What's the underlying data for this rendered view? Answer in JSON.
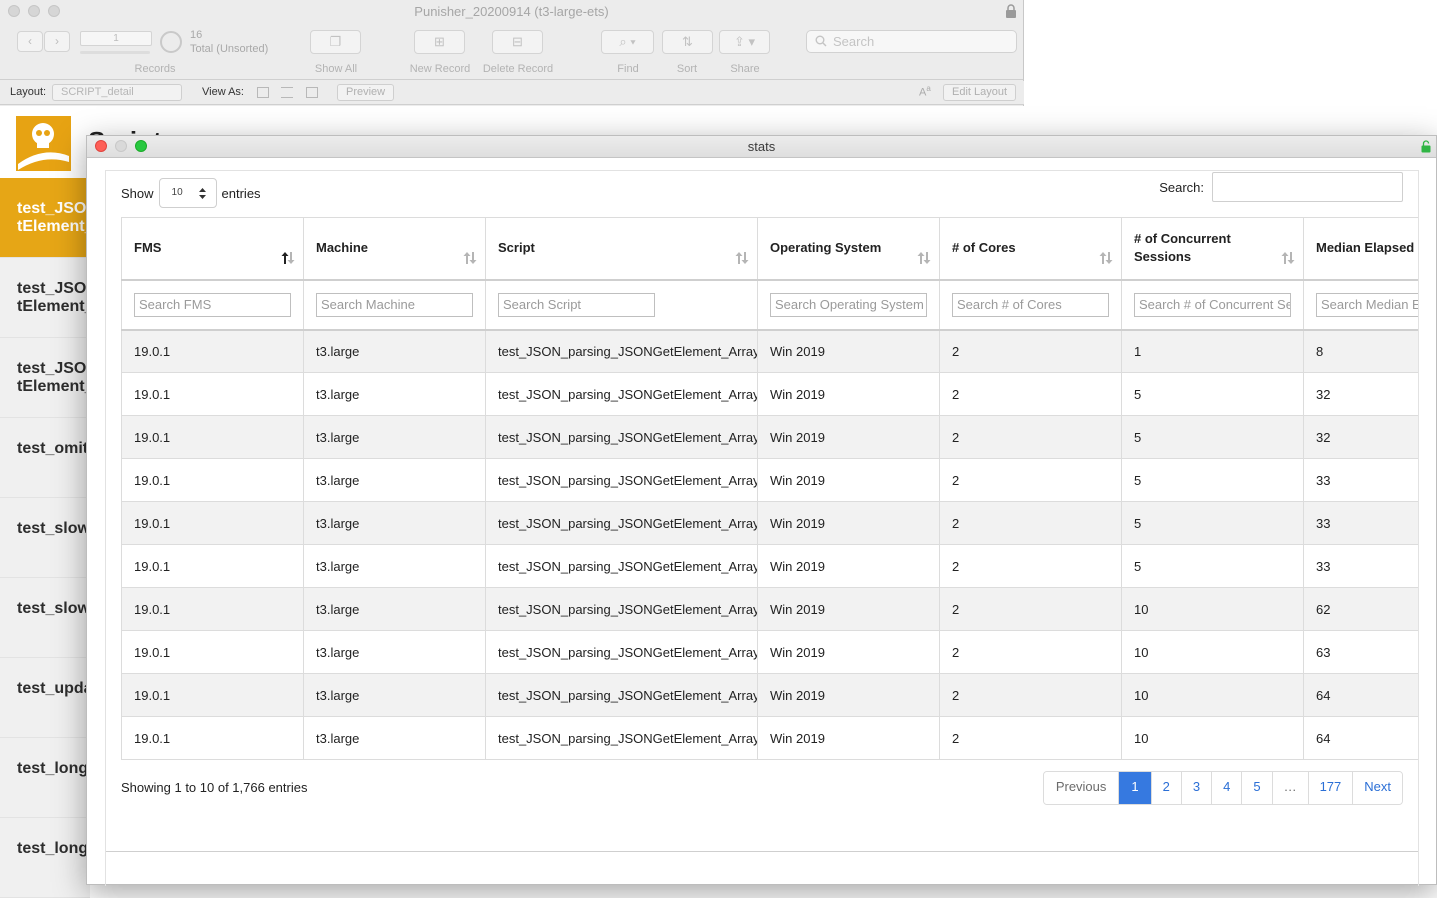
{
  "fm_window": {
    "title": "Punisher_20200914 (t3-large-ets)",
    "record_input": "1",
    "record_count": "16",
    "record_status": "Total (Unsorted)",
    "records_label": "Records",
    "show_all_label": "Show All",
    "new_record_label": "New Record",
    "delete_record_label": "Delete Record",
    "find_label": "Find",
    "sort_label": "Sort",
    "share_label": "Share",
    "search_placeholder": "Search",
    "layout_label": "Layout:",
    "layout_value": "SCRIPT_detail",
    "view_as_label": "View As:",
    "preview_label": "Preview",
    "edit_layout_label": "Edit Layout",
    "heading": "Script",
    "list_items": [
      {
        "line1": "test_JSO",
        "line2": "tElement_"
      },
      {
        "line1": "test_JSO",
        "line2": "tElement_"
      },
      {
        "line1": "test_JSO",
        "line2": "tElement_"
      },
      {
        "line1": "test_omit",
        "line2": ""
      },
      {
        "line1": "test_slow",
        "line2": ""
      },
      {
        "line1": "test_slow",
        "line2": ""
      },
      {
        "line1": "test_upda",
        "line2": ""
      },
      {
        "line1": "test_long",
        "line2": ""
      },
      {
        "line1": "test_long",
        "line2": ""
      }
    ]
  },
  "stats_window": {
    "title": "stats",
    "show_label": "Show",
    "entries_label": "entries",
    "page_length": "10",
    "search_label": "Search:",
    "columns": [
      {
        "label": "FMS",
        "filter_placeholder": "Search FMS"
      },
      {
        "label": "Machine",
        "filter_placeholder": "Search Machine"
      },
      {
        "label": "Script",
        "filter_placeholder": "Search Script"
      },
      {
        "label": "Operating System",
        "filter_placeholder": "Search Operating System"
      },
      {
        "label": "# of Cores",
        "filter_placeholder": "Search # of Cores"
      },
      {
        "label": "# of Concurrent Sessions",
        "filter_placeholder": "Search # of Concurrent Se"
      },
      {
        "label": "Median Elapsed T",
        "filter_placeholder": "Search Median El"
      }
    ],
    "rows": [
      [
        "19.0.1",
        "t3.large",
        "test_JSON_parsing_JSONGetElement_Array",
        "Win 2019",
        "2",
        "1",
        "8"
      ],
      [
        "19.0.1",
        "t3.large",
        "test_JSON_parsing_JSONGetElement_Array",
        "Win 2019",
        "2",
        "5",
        "32"
      ],
      [
        "19.0.1",
        "t3.large",
        "test_JSON_parsing_JSONGetElement_Array",
        "Win 2019",
        "2",
        "5",
        "32"
      ],
      [
        "19.0.1",
        "t3.large",
        "test_JSON_parsing_JSONGetElement_Array",
        "Win 2019",
        "2",
        "5",
        "33"
      ],
      [
        "19.0.1",
        "t3.large",
        "test_JSON_parsing_JSONGetElement_Array",
        "Win 2019",
        "2",
        "5",
        "33"
      ],
      [
        "19.0.1",
        "t3.large",
        "test_JSON_parsing_JSONGetElement_Array",
        "Win 2019",
        "2",
        "5",
        "33"
      ],
      [
        "19.0.1",
        "t3.large",
        "test_JSON_parsing_JSONGetElement_Array",
        "Win 2019",
        "2",
        "10",
        "62"
      ],
      [
        "19.0.1",
        "t3.large",
        "test_JSON_parsing_JSONGetElement_Array",
        "Win 2019",
        "2",
        "10",
        "63"
      ],
      [
        "19.0.1",
        "t3.large",
        "test_JSON_parsing_JSONGetElement_Array",
        "Win 2019",
        "2",
        "10",
        "64"
      ],
      [
        "19.0.1",
        "t3.large",
        "test_JSON_parsing_JSONGetElement_Array",
        "Win 2019",
        "2",
        "10",
        "64"
      ]
    ],
    "info": "Showing 1 to 10 of 1,766 entries",
    "pagination": {
      "previous": "Previous",
      "pages": [
        "1",
        "2",
        "3",
        "4",
        "5"
      ],
      "ellipsis": "…",
      "last": "177",
      "next": "Next",
      "current": "1"
    }
  },
  "colors": {
    "accent_blue": "#3679e0",
    "list_active": "#e6a616",
    "close_red": "#fe5f57",
    "max_green": "#28c840"
  }
}
